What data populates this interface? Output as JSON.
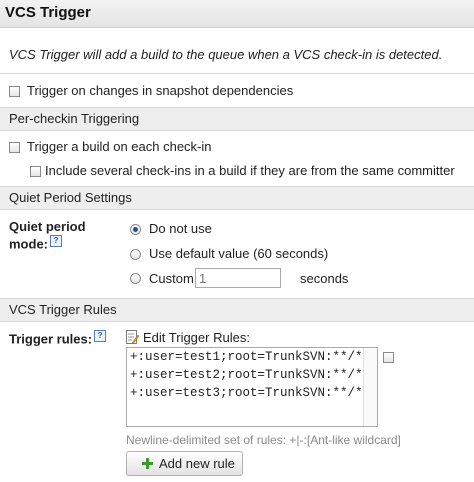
{
  "title": "VCS Trigger",
  "intro": "VCS Trigger will add a build to the queue when a VCS check-in is detected.",
  "snapshot_option": {
    "label": "Trigger on changes in snapshot dependencies",
    "checked": false
  },
  "per_checkin": {
    "header": "Per-checkin Triggering",
    "each_checkin": {
      "label": "Trigger a build on each check-in",
      "checked": false
    },
    "several_checkins": {
      "label": "Include several check-ins in a build if they are from the same committer",
      "checked": false
    }
  },
  "quiet_period": {
    "header": "Quiet Period Settings",
    "label_line1": "Quiet period",
    "label_line2": "mode:",
    "help": "?",
    "options": [
      {
        "label": "Do not use",
        "selected": true
      },
      {
        "label": "Use default value (60 seconds)",
        "selected": false
      },
      {
        "label": "Custom",
        "selected": false
      }
    ],
    "custom_value": "",
    "custom_placeholder": "1",
    "seconds_label": "seconds"
  },
  "rules": {
    "header": "VCS Trigger Rules",
    "label": "Trigger rules:",
    "help": "?",
    "edit_label": "Edit Trigger Rules:",
    "lines": [
      "+:user=test1;root=TrunkSVN:**/*",
      "+:user=test2;root=TrunkSVN:**/*",
      "+:user=test3;root=TrunkSVN:**/*"
    ],
    "hint": "Newline-delimited set of rules: +|-:[Ant-like wildcard]",
    "add_button": "Add new rule"
  }
}
